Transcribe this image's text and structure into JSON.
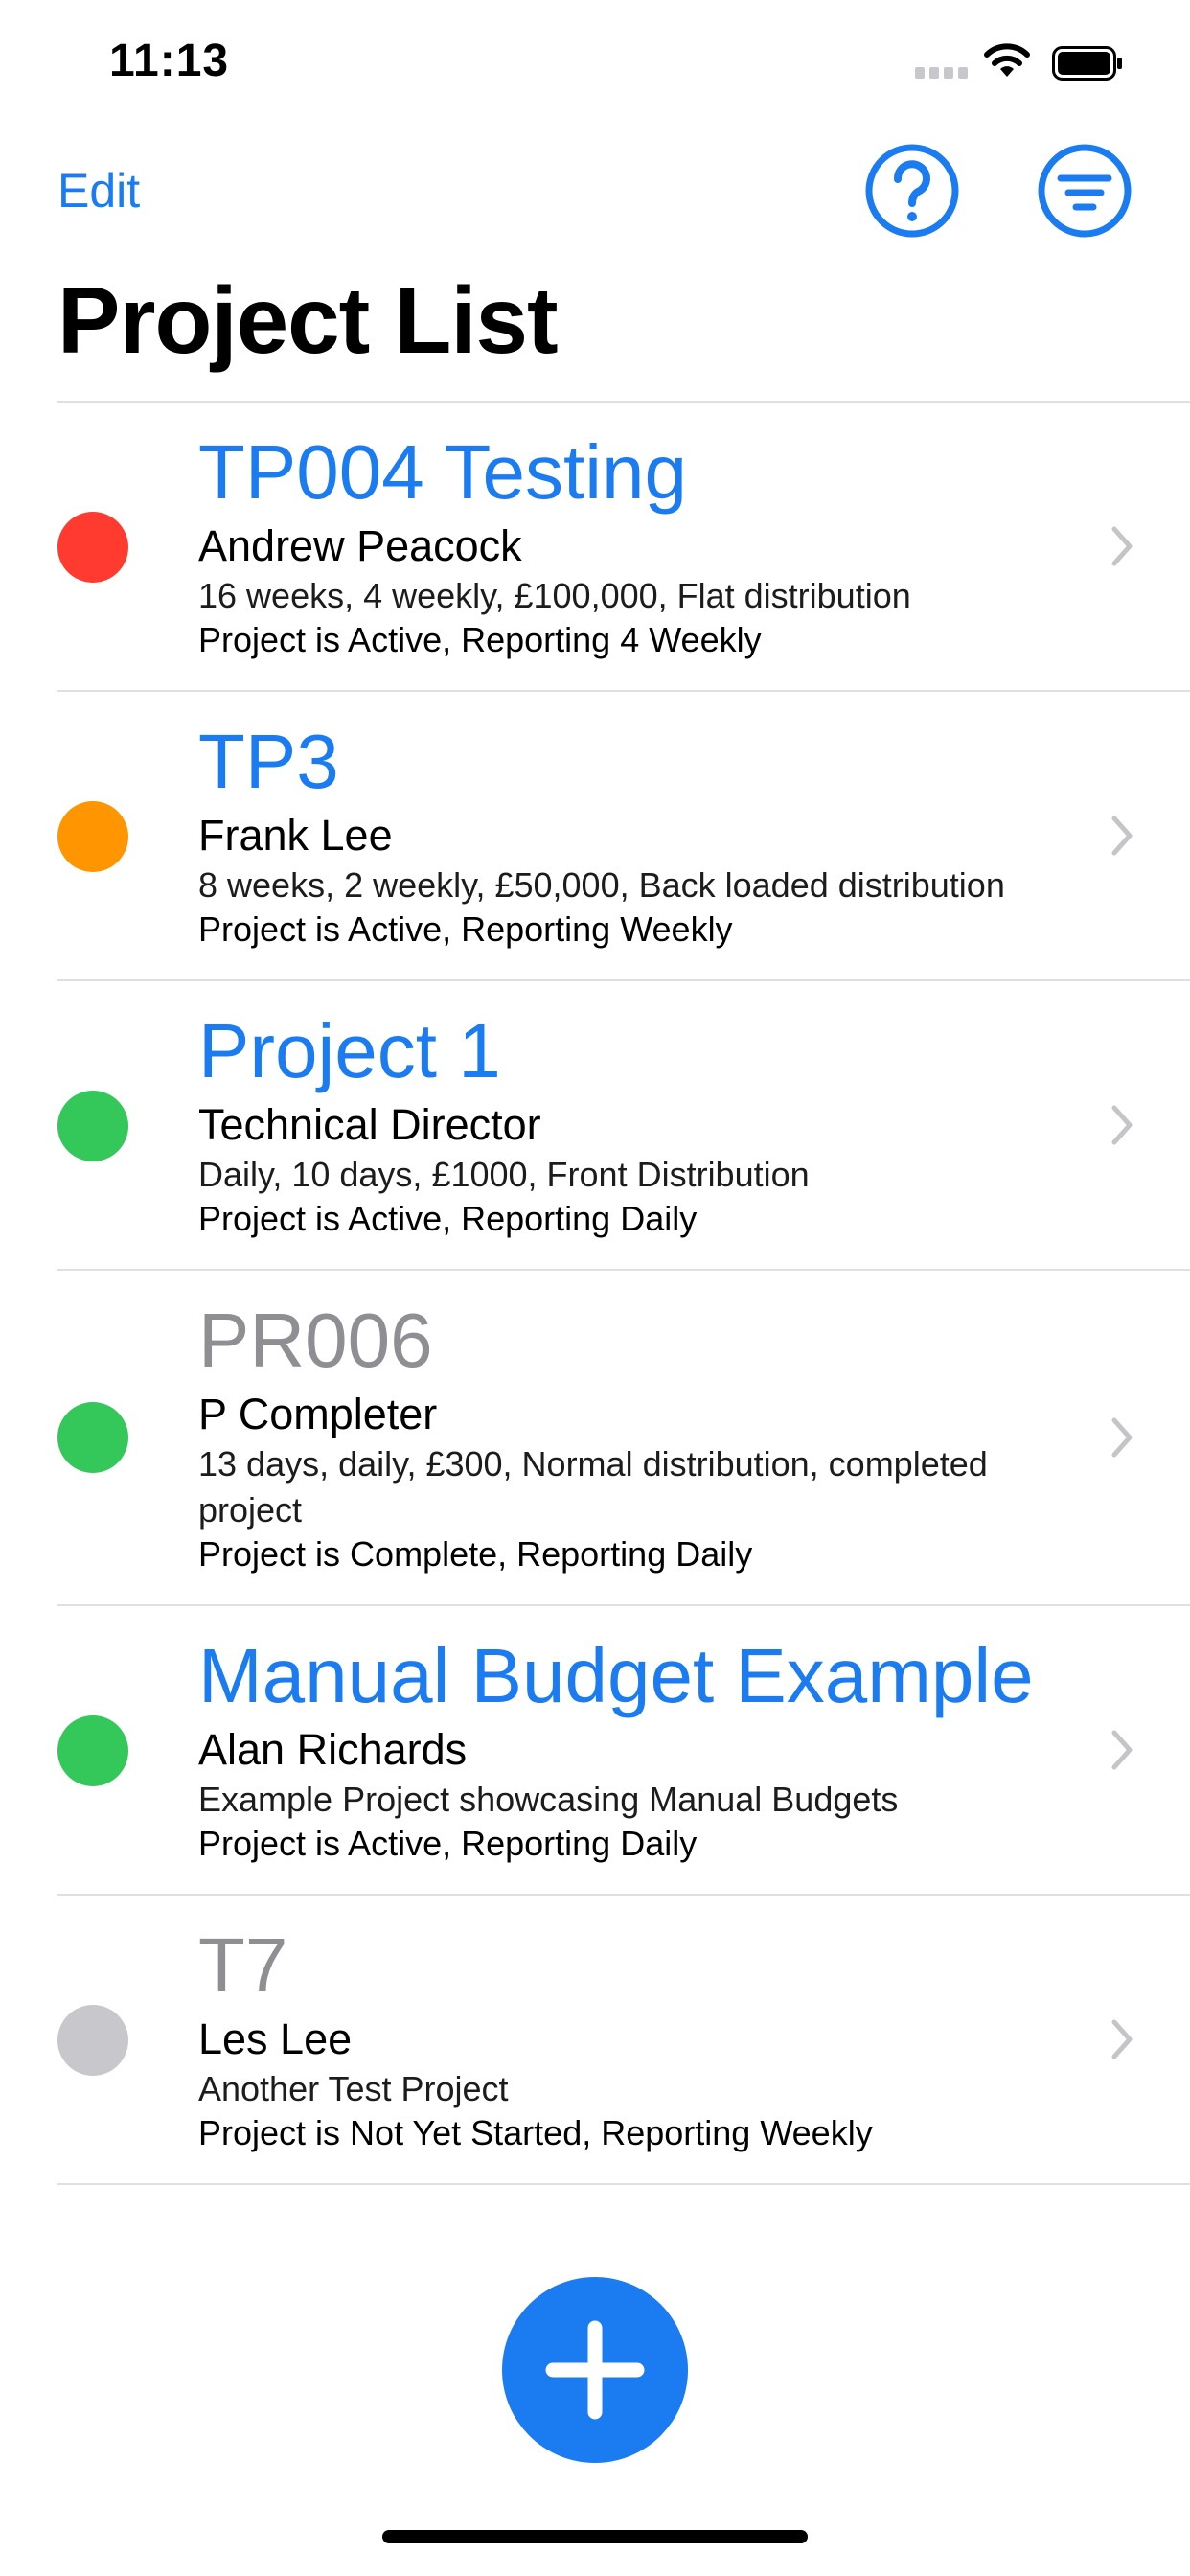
{
  "status_bar": {
    "time": "11:13"
  },
  "nav": {
    "edit_label": "Edit",
    "help_icon": "question-circle-icon",
    "filter_icon": "filter-lines-icon"
  },
  "page_title": "Project List",
  "colors": {
    "accent": "#1a7cf0",
    "status_red": "#ff3b30",
    "status_orange": "#ff9500",
    "status_green": "#34c759",
    "status_gray": "#c7c7cc",
    "inactive_title": "#8e8e93"
  },
  "projects": [
    {
      "title": "TP004 Testing",
      "owner": "Andrew Peacock",
      "details": "16 weeks, 4 weekly, £100,000, Flat distribution",
      "state": "Project is Active, Reporting 4 Weekly",
      "status_color": "#ff3b30",
      "title_style": "active"
    },
    {
      "title": "TP3",
      "owner": "Frank Lee",
      "details": "8 weeks, 2 weekly, £50,000, Back loaded distribution",
      "state": "Project is Active, Reporting Weekly",
      "status_color": "#ff9500",
      "title_style": "active"
    },
    {
      "title": "Project 1",
      "owner": "Technical Director",
      "details": "Daily, 10 days, £1000, Front Distribution",
      "state": "Project is Active, Reporting Daily",
      "status_color": "#34c759",
      "title_style": "active"
    },
    {
      "title": "PR006",
      "owner": "P Completer",
      "details": "13 days, daily, £300, Normal distribution, completed project",
      "state": "Project is Complete, Reporting Daily",
      "status_color": "#34c759",
      "title_style": "inactive"
    },
    {
      "title": "Manual Budget Example",
      "owner": "Alan Richards",
      "details": "Example Project showcasing Manual Budgets",
      "state": "Project is Active, Reporting Daily",
      "status_color": "#34c759",
      "title_style": "active"
    },
    {
      "title": "T7",
      "owner": "Les Lee",
      "details": "Another Test Project",
      "state": "Project is Not Yet Started, Reporting Weekly",
      "status_color": "#c7c7cc",
      "title_style": "inactive"
    }
  ],
  "add_button_icon": "plus-icon"
}
